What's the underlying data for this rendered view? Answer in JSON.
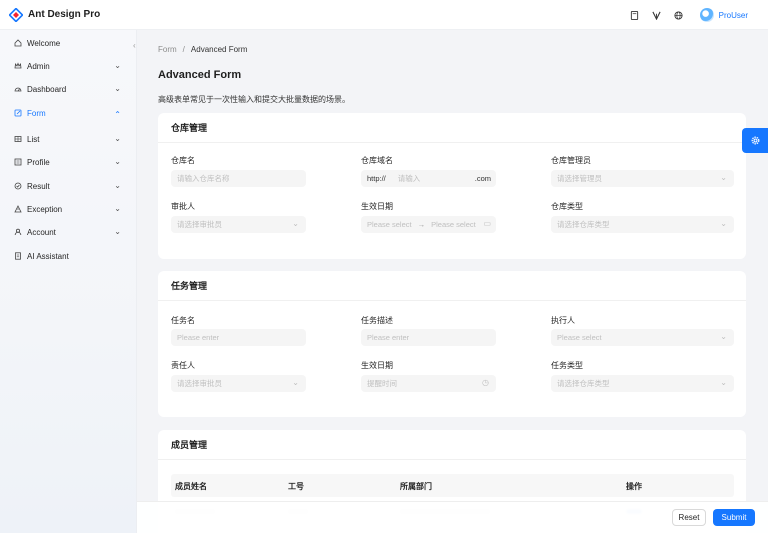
{
  "app": {
    "title": "Ant Design Pro"
  },
  "header": {
    "user_name": "ProUser"
  },
  "sidebar": {
    "items": [
      {
        "label": "Welcome",
        "icon": "home-icon"
      },
      {
        "label": "Admin",
        "icon": "crown-icon"
      },
      {
        "label": "Dashboard",
        "icon": "dashboard-icon"
      },
      {
        "label": "Form",
        "icon": "form-icon"
      },
      {
        "label": "List",
        "icon": "table-icon"
      },
      {
        "label": "Profile",
        "icon": "profile-icon"
      },
      {
        "label": "Result",
        "icon": "check-circle-icon"
      },
      {
        "label": "Exception",
        "icon": "warning-icon"
      },
      {
        "label": "Account",
        "icon": "user-icon"
      },
      {
        "label": "AI Assistant",
        "icon": "file-icon"
      }
    ]
  },
  "breadcrumb": {
    "parent": "Form",
    "separator": "/",
    "current": "Advanced Form"
  },
  "page": {
    "title": "Advanced Form",
    "description": "高级表单常见于一次性输入和提交大批量数据的场景。"
  },
  "warehouse": {
    "title": "仓库管理",
    "name_label": "仓库名",
    "name_placeholder": "请输入仓库名称",
    "domain_label": "仓库域名",
    "domain_prefix": "http://",
    "domain_placeholder": "请输入",
    "domain_suffix": ".com",
    "admin_label": "仓库管理员",
    "admin_placeholder": "请选择管理员",
    "approver_label": "审批人",
    "approver_placeholder": "请选择审批员",
    "date_label": "生效日期",
    "date_start_placeholder": "Please select",
    "date_end_placeholder": "Please select",
    "type_label": "仓库类型",
    "type_placeholder": "请选择仓库类型"
  },
  "task": {
    "title": "任务管理",
    "name_label": "任务名",
    "name_placeholder": "Please enter",
    "desc_label": "任务描述",
    "desc_placeholder": "Please enter",
    "executor_label": "执行人",
    "executor_placeholder": "Please select",
    "owner_label": "责任人",
    "owner_placeholder": "请选择审批员",
    "date_label": "生效日期",
    "date_placeholder": "提醒时间",
    "type_label": "任务类型",
    "type_placeholder": "请选择仓库类型"
  },
  "members": {
    "title": "成员管理",
    "columns": [
      "成员姓名",
      "工号",
      "所属部门",
      "操作"
    ]
  },
  "footer": {
    "reset_label": "Reset",
    "submit_label": "Submit"
  },
  "colors": {
    "primary": "#1677ff",
    "background": "#f3f4f7"
  }
}
